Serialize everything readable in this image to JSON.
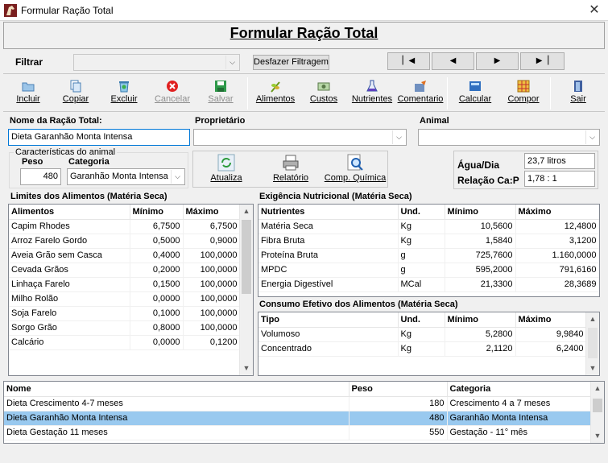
{
  "window": {
    "title": "Formular Ração Total"
  },
  "header": {
    "title": "Formular Ração Total"
  },
  "filter": {
    "label": "Filtrar",
    "value": "",
    "undo_label": "Desfazer Filtragem"
  },
  "nav": {
    "first": "▏◀",
    "prev": "◀",
    "next": "▶",
    "last": "▶▕"
  },
  "toolbar": [
    {
      "label": "Incluir",
      "icon": "folder-icon",
      "disabled": false
    },
    {
      "label": "Copiar",
      "icon": "copy-icon",
      "disabled": false
    },
    {
      "label": "Excluir",
      "icon": "recycle-bin-icon",
      "disabled": false
    },
    {
      "label": "Cancelar",
      "icon": "cancel-icon",
      "disabled": true
    },
    {
      "label": "Salvar",
      "icon": "save-icon",
      "disabled": true
    },
    {
      "label": "Alimentos",
      "icon": "plant-icon",
      "disabled": false
    },
    {
      "label": "Custos",
      "icon": "money-icon",
      "disabled": false
    },
    {
      "label": "Nutrientes",
      "icon": "flask-icon",
      "disabled": false
    },
    {
      "label": "Comentario",
      "icon": "comment-icon",
      "disabled": false
    },
    {
      "label": "Calcular",
      "icon": "calculator-icon",
      "disabled": false
    },
    {
      "label": "Compor",
      "icon": "compose-icon",
      "disabled": false
    },
    {
      "label": "Sair",
      "icon": "exit-door-icon",
      "disabled": false
    }
  ],
  "form": {
    "nome_label": "Nome da Ração Total:",
    "nome_value": "Dieta Garanhão Monta Intensa",
    "proprietario_label": "Proprietário",
    "proprietario_value": "",
    "animal_label": "Animal",
    "animal_value": "",
    "caracteristicas_label": "Características do animal",
    "peso_label": "Peso",
    "peso_value": "480",
    "categoria_label": "Categoria",
    "categoria_value": "Garanhão Monta Intensa",
    "agua_label": "Água/Dia",
    "agua_value": "23,7 litros",
    "relacao_label": "Relação Ca:P",
    "relacao_value": "1,78  :  1"
  },
  "actions": {
    "atualiza": "Atualiza",
    "relatorio": "Relatório",
    "comp_quimica": "Comp. Química"
  },
  "limites": {
    "title": "Limites dos Alimentos (Matéria Seca)",
    "headers": [
      "Alimentos",
      "Mínimo",
      "Máximo"
    ],
    "rows": [
      [
        "Capim Rhodes",
        "6,7500",
        "6,7500"
      ],
      [
        "Arroz Farelo Gordo",
        "0,5000",
        "0,9000"
      ],
      [
        "Aveia Grão sem Casca",
        "0,4000",
        "100,0000"
      ],
      [
        "Cevada Grãos",
        "0,2000",
        "100,0000"
      ],
      [
        "Linhaça Farelo",
        "0,1500",
        "100,0000"
      ],
      [
        "Milho Rolão",
        "0,0000",
        "100,0000"
      ],
      [
        "Soja Farelo",
        "0,1000",
        "100,0000"
      ],
      [
        "Sorgo Grão",
        "0,8000",
        "100,0000"
      ],
      [
        "Calcário",
        "0,0000",
        "0,1200"
      ]
    ]
  },
  "exigencia": {
    "title": "Exigência Nutricional (Matéria Seca)",
    "headers": [
      "Nutrientes",
      "Und.",
      "Mínimo",
      "Máximo"
    ],
    "rows": [
      [
        "Matéria Seca",
        "Kg",
        "10,5600",
        "12,4800"
      ],
      [
        "Fibra Bruta",
        "Kg",
        "1,5840",
        "3,1200"
      ],
      [
        "Proteína Bruta",
        "g",
        "725,7600",
        "1.160,0000"
      ],
      [
        "MPDC",
        "g",
        "595,2000",
        "791,6160"
      ],
      [
        "Energia Digestível",
        "MCal",
        "21,3300",
        "28,3689"
      ]
    ]
  },
  "consumo": {
    "title": "Consumo Efetivo dos Alimentos (Matéria Seca)",
    "headers": [
      "Tipo",
      "Und.",
      "Mínimo",
      "Máximo"
    ],
    "rows": [
      [
        "Volumoso",
        "Kg",
        "5,2800",
        "9,9840"
      ],
      [
        "Concentrado",
        "Kg",
        "2,1120",
        "6,2400"
      ]
    ]
  },
  "lista": {
    "headers": [
      "Nome",
      "Peso",
      "Categoria"
    ],
    "rows": [
      [
        "Dieta Crescimento 4-7 meses",
        "180",
        "Crescimento 4 a 7 meses"
      ],
      [
        "Dieta Garanhão Monta Intensa",
        "480",
        "Garanhão Monta Intensa"
      ],
      [
        "Dieta Gestação 11 meses",
        "550",
        "Gestação - 11° mês"
      ]
    ],
    "selected": 1
  }
}
